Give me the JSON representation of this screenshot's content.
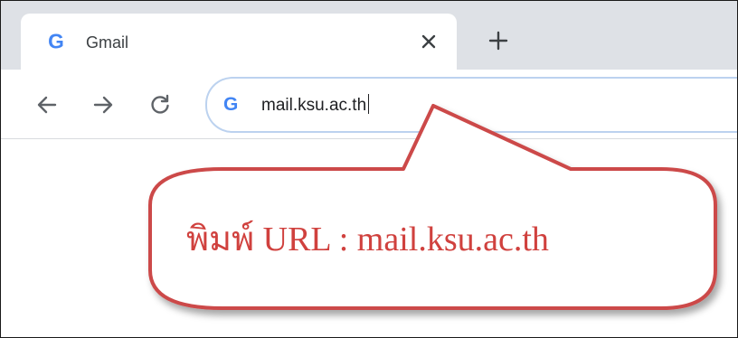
{
  "browser": {
    "tab": {
      "title": "Gmail",
      "favicon": "google-g-icon",
      "close_icon": "close-icon"
    },
    "new_tab_icon": "plus-icon",
    "nav": {
      "back_icon": "arrow-left-icon",
      "forward_icon": "arrow-right-icon",
      "reload_icon": "reload-icon"
    },
    "address_bar": {
      "favicon": "google-g-icon",
      "url": "mail.ksu.ac.th"
    }
  },
  "callout": {
    "text": "พิมพ์ URL : mail.ksu.ac.th",
    "border_color": "#cc4a48",
    "text_color": "#d0413e"
  },
  "colors": {
    "tabstrip": "#dee1e6",
    "omnibox_border": "#bcd2ef"
  }
}
